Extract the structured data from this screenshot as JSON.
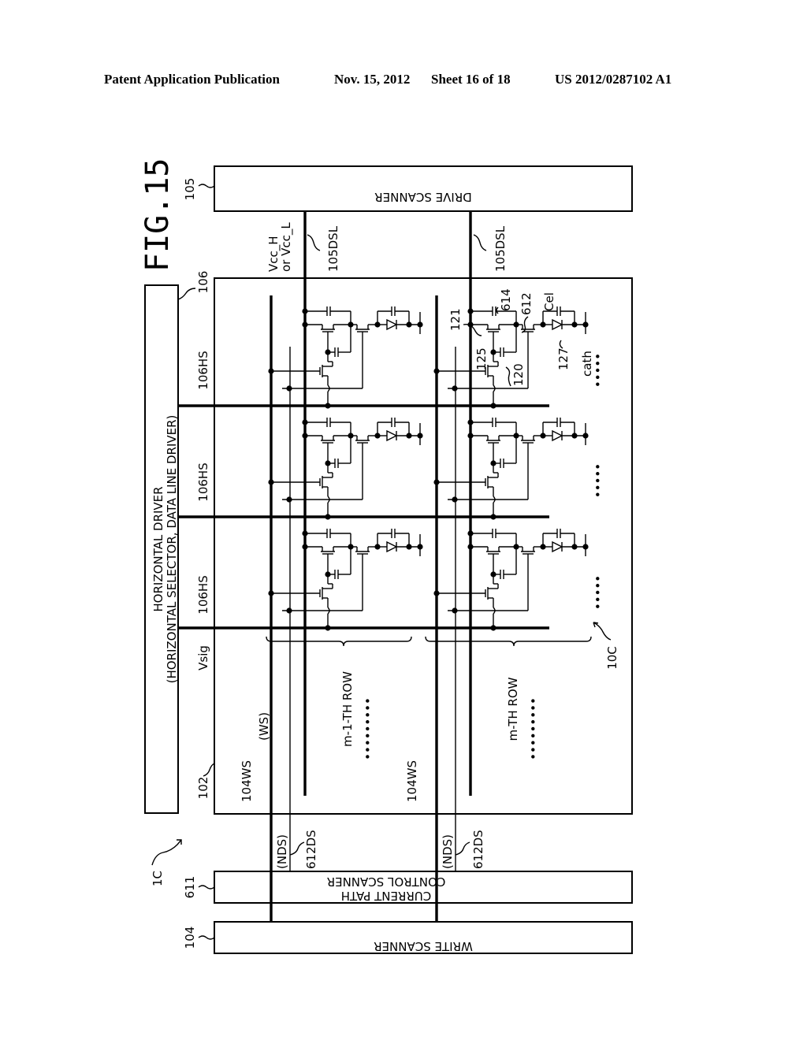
{
  "header": {
    "publication": "Patent Application Publication",
    "date": "Nov. 15, 2012",
    "sheet": "Sheet 16 of 18",
    "number": "US 2012/0287102 A1"
  },
  "figure": {
    "title": "FIG.15",
    "blocks": {
      "drive_scanner": {
        "ref": "105",
        "label": "DRIVE SCANNER"
      },
      "horizontal_driver": {
        "ref": "106",
        "line1": "HORIZONTAL DRIVER",
        "line2": "(HORIZONTAL SELECTOR, DATA LINE DRIVER)"
      },
      "pixel_array": {
        "ref": "102",
        "array_ref": "10C"
      },
      "current_path_scanner": {
        "ref": "611",
        "line1": "CURRENT PATH",
        "line2": "CONTROL SCANNER"
      },
      "write_scanner": {
        "ref": "104",
        "label": "WRITE SCANNER"
      }
    },
    "device_ref": "1C",
    "signals": {
      "vsig": "Vsig",
      "vcc_line1": "Vcc_H",
      "vcc_line2": "or Vcc_L",
      "dsl": "105DSL",
      "hs": "106HS",
      "ws_ref": "104WS",
      "ws": "(WS)",
      "nds": "(NDS)",
      "ds612": "612DS"
    },
    "components": {
      "c121": "121",
      "c125": "125",
      "c120": "120",
      "c614": "614",
      "c612": "612",
      "cel": "Cel",
      "c127": "127",
      "cath": "cath"
    },
    "rows": [
      "m-1-TH ROW",
      "m-TH ROW"
    ],
    "ellipsis": "•••••",
    "ellipsis_long": "•••••••••"
  }
}
